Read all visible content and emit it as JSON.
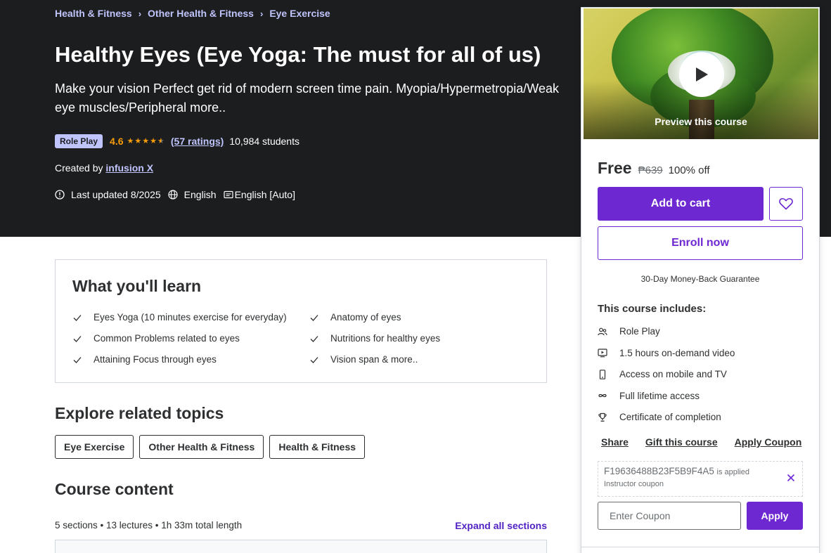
{
  "breadcrumb": {
    "items": [
      "Health & Fitness",
      "Other Health & Fitness",
      "Eye Exercise"
    ]
  },
  "course": {
    "title": "Healthy Eyes (Eye Yoga: The must for all of us)",
    "subtitle": "Make your vision Perfect get rid of modern screen time pain. Myopia/Hypermetropia/Weak eye muscles/Peripheral more..",
    "badge": "Role Play",
    "rating": "4.6",
    "rating_value": 4.6,
    "ratings_count": "(57 ratings)",
    "students": "10,984 students",
    "created_by_label": "Created by",
    "instructor": "infusion X",
    "last_updated": "Last updated 8/2025",
    "language": "English",
    "captions": "English [Auto]"
  },
  "learn": {
    "title": "What you'll learn",
    "items": [
      "Eyes Yoga (10 minutes exercise for everyday)",
      "Anatomy of eyes",
      "Common Problems related to eyes",
      "Nutritions for healthy eyes",
      "Attaining Focus through eyes",
      "Vision span & more.."
    ]
  },
  "related": {
    "title": "Explore related topics",
    "topics": [
      "Eye Exercise",
      "Other Health & Fitness",
      "Health & Fitness"
    ]
  },
  "content": {
    "title": "Course content",
    "summary": "5 sections • 13 lectures • 1h 33m total length",
    "expand_label": "Expand all sections"
  },
  "sidebar": {
    "preview_label": "Preview this course",
    "price_now": "Free",
    "price_old": "₱639",
    "discount": "100% off",
    "add_to_cart": "Add to cart",
    "enroll": "Enroll now",
    "guarantee": "30-Day Money-Back Guarantee",
    "includes_title": "This course includes:",
    "includes": [
      {
        "icon": "people-icon",
        "label": "Role Play"
      },
      {
        "icon": "video-icon",
        "label": "1.5 hours on-demand video"
      },
      {
        "icon": "mobile-icon",
        "label": "Access on mobile and TV"
      },
      {
        "icon": "infinity-icon",
        "label": "Full lifetime access"
      },
      {
        "icon": "trophy-icon",
        "label": "Certificate of completion"
      }
    ],
    "share": "Share",
    "gift": "Gift this course",
    "apply_coupon": "Apply Coupon",
    "coupon_code": "F19636488B23F5B9F4A5",
    "coupon_applied": "is applied",
    "coupon_type": "Instructor coupon",
    "coupon_placeholder": "Enter Coupon",
    "apply": "Apply"
  },
  "colors": {
    "hero_bg": "#1c1d1f",
    "accent": "#6d28d2",
    "link_light": "#c0c4fc",
    "star": "#f69c08"
  }
}
